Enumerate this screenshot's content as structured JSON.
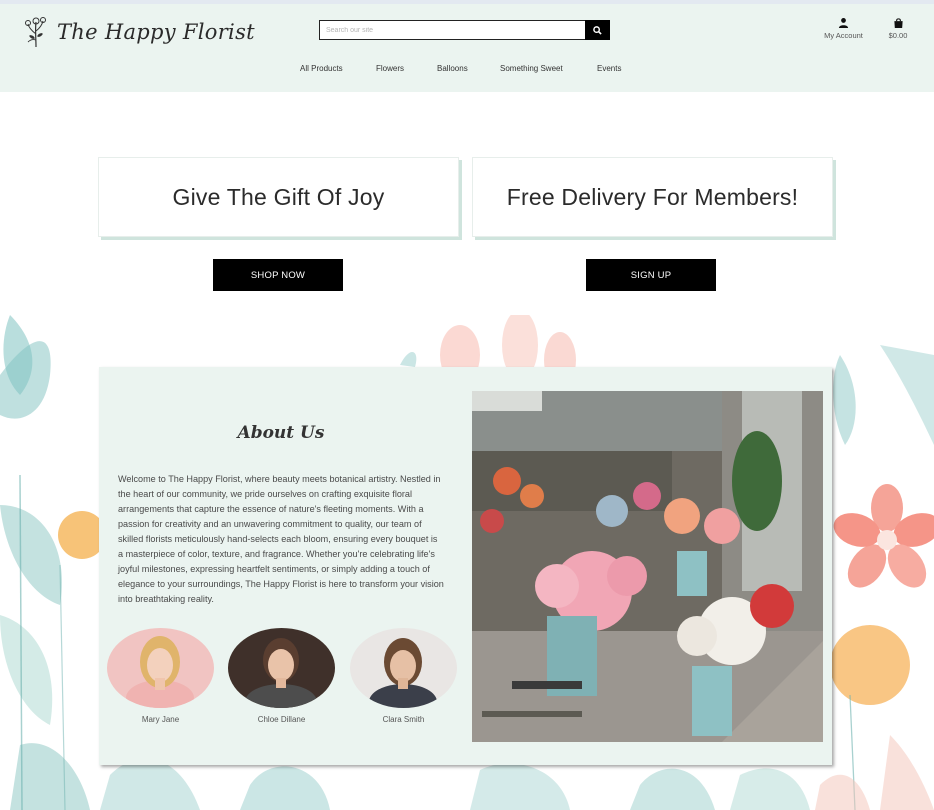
{
  "brand": {
    "name": "The Happy Florist"
  },
  "search": {
    "placeholder": "Search our site",
    "icon": "search-icon"
  },
  "account": {
    "label": "My Account",
    "icon": "user-icon"
  },
  "cart": {
    "total": "$0.00",
    "icon": "shopping-bag-icon"
  },
  "nav": {
    "items": [
      {
        "label": "All Products"
      },
      {
        "label": "Flowers"
      },
      {
        "label": "Balloons"
      },
      {
        "label": "Something Sweet"
      },
      {
        "label": "Events"
      }
    ]
  },
  "hero": {
    "left_card": "Give The Gift Of Joy",
    "right_card": "Free Delivery For Members!",
    "left_button": "SHOP NOW",
    "right_button": "SIGN UP"
  },
  "about": {
    "title": "About Us",
    "text": "Welcome to The Happy Florist, where beauty meets botanical artistry. Nestled in the heart of our community, we pride ourselves on crafting exquisite floral arrangements that capture the essence of nature's fleeting moments. With a passion for creativity and an unwavering commitment to quality, our team of skilled florists meticulously hand-selects each bloom, ensuring every bouquet is a masterpiece of color, texture, and fragrance. Whether you're celebrating life's joyful milestones, expressing heartfelt sentiments, or simply adding a touch of elegance to your surroundings, The Happy Florist is here to transform your vision into breathtaking reality.",
    "team": [
      {
        "name": "Mary Jane"
      },
      {
        "name": "Chloe Dillane"
      },
      {
        "name": "Clara Smith"
      }
    ]
  },
  "colors": {
    "header_bg": "#ebf4f0",
    "about_bg": "#ebf4f0",
    "card_shadow": "#cfe4dd",
    "button_bg": "#000000",
    "button_text": "#ffffff"
  }
}
